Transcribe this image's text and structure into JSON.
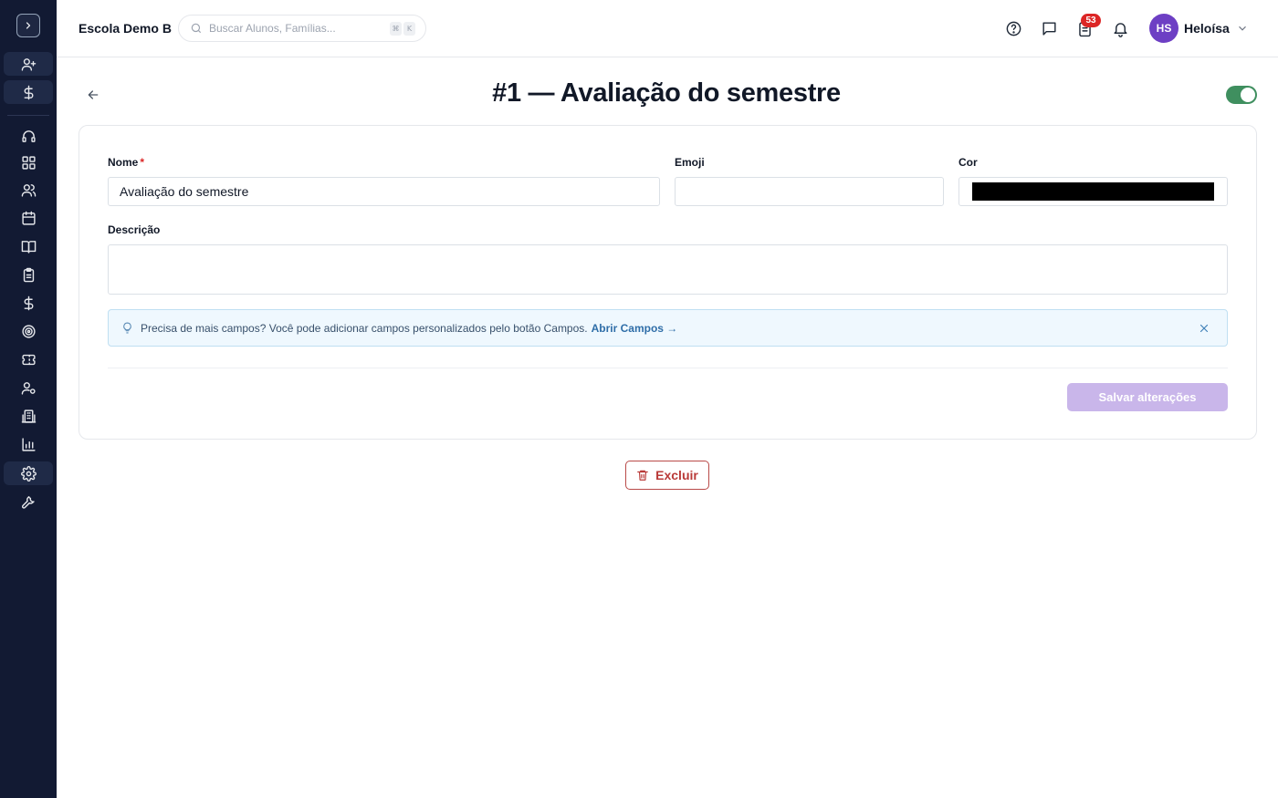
{
  "header": {
    "school_name": "Escola Demo B",
    "search_placeholder": "Buscar Alunos, Famílias...",
    "shortcut_keys": [
      "⌘",
      "K"
    ],
    "notification_count": "53",
    "user_initials": "HS",
    "user_name": "Heloísa"
  },
  "sidebar": {
    "items": [
      {
        "name": "add-user-icon"
      },
      {
        "name": "dollar-icon"
      },
      {
        "name": "headset-icon"
      },
      {
        "name": "dashboard-icon"
      },
      {
        "name": "users-icon"
      },
      {
        "name": "calendar-icon"
      },
      {
        "name": "book-open-icon"
      },
      {
        "name": "clipboard-icon"
      },
      {
        "name": "dollar-icon"
      },
      {
        "name": "target-icon"
      },
      {
        "name": "ticket-icon"
      },
      {
        "name": "user-settings-icon"
      },
      {
        "name": "building-icon"
      },
      {
        "name": "bar-chart-icon"
      },
      {
        "name": "gear-icon"
      },
      {
        "name": "wrench-icon"
      }
    ]
  },
  "page": {
    "title": "#1 — Avaliação do semestre",
    "active": true
  },
  "form": {
    "name_label": "Nome",
    "required_mark": "*",
    "name_value": "Avaliação do semestre",
    "emoji_label": "Emoji",
    "emoji_value": "",
    "color_label": "Cor",
    "color_value": "#000000",
    "description_label": "Descrição",
    "description_value": "",
    "info_text": "Precisa de mais campos? Você pode adicionar campos personalizados pelo botão Campos.",
    "info_link": "Abrir Campos →",
    "save_label": "Salvar alterações"
  },
  "actions": {
    "delete_label": "Excluir"
  }
}
